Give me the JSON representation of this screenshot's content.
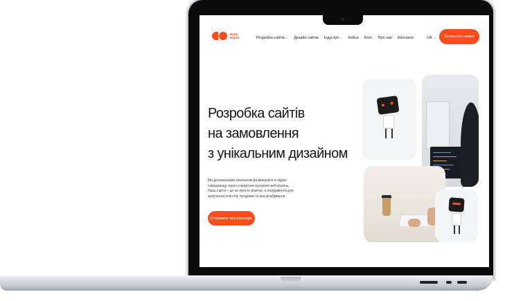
{
  "brand": {
    "logo_text": "Dobe Digital",
    "accent": "#ff4d1f"
  },
  "nav": {
    "items": [
      {
        "label": "Розробка сайтів",
        "dropdown": true
      },
      {
        "label": "Дизайн сайтів",
        "dropdown": false
      },
      {
        "label": "Індустрії",
        "dropdown": true
      },
      {
        "label": "Кейси",
        "dropdown": false
      },
      {
        "label": "Блог",
        "dropdown": false
      },
      {
        "label": "Про нас",
        "dropdown": false
      },
      {
        "label": "Контакти",
        "dropdown": false
      }
    ],
    "language": "UA",
    "cta": "Залишити заявку"
  },
  "hero": {
    "title_lines": [
      "Розробка сайтів",
      "на замовлення",
      "з унікальним дизайном"
    ],
    "description": "Ми допомагаємо компаніям розвиватися в digital-середовищі через створення сучасних веб-рішень. Наші сайти – це не просто візитки, а інструменти для залучення клієнтів, продажів та масштабування.",
    "cta": "Отримати консультацію"
  },
  "icons": {
    "chevron": "chevron-down-icon",
    "robot": "robot-mascot"
  }
}
